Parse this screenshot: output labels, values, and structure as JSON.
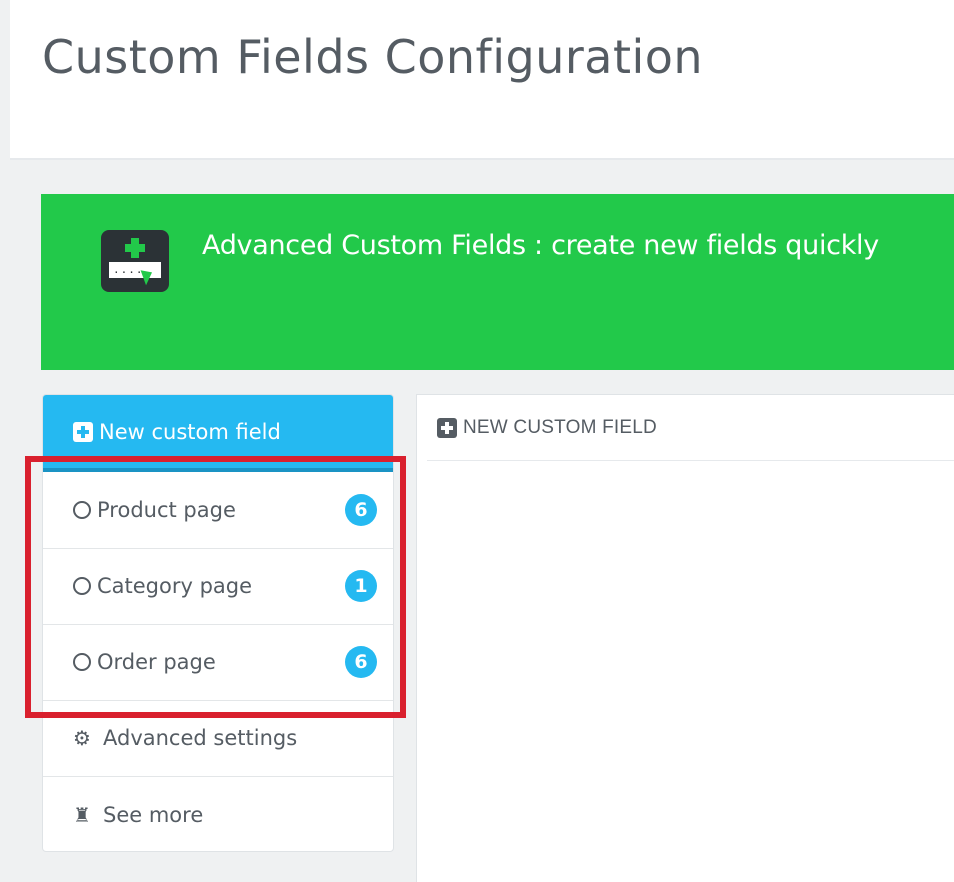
{
  "header": {
    "title": "Custom Fields Configuration"
  },
  "banner": {
    "text": "Advanced Custom Fields : create new fields quickly",
    "icon": "add-field-icon",
    "color": "#22c94a"
  },
  "sidebar": {
    "active_item": {
      "label": "New custom field",
      "icon": "plus-square-icon"
    },
    "items": [
      {
        "label": "Product page",
        "icon": "circle-icon",
        "count": "6"
      },
      {
        "label": "Category page",
        "icon": "circle-icon",
        "count": "1"
      },
      {
        "label": "Order page",
        "icon": "circle-icon",
        "count": "6"
      },
      {
        "label": "Advanced settings",
        "icon": "gear-icon"
      },
      {
        "label": "See more",
        "icon": "puzzle-icon"
      }
    ],
    "accent_color": "#25b9f1"
  },
  "main": {
    "heading": "NEW CUSTOM FIELD",
    "heading_icon": "plus-square-icon"
  },
  "annotation": {
    "highlight_color": "#d9202e"
  }
}
